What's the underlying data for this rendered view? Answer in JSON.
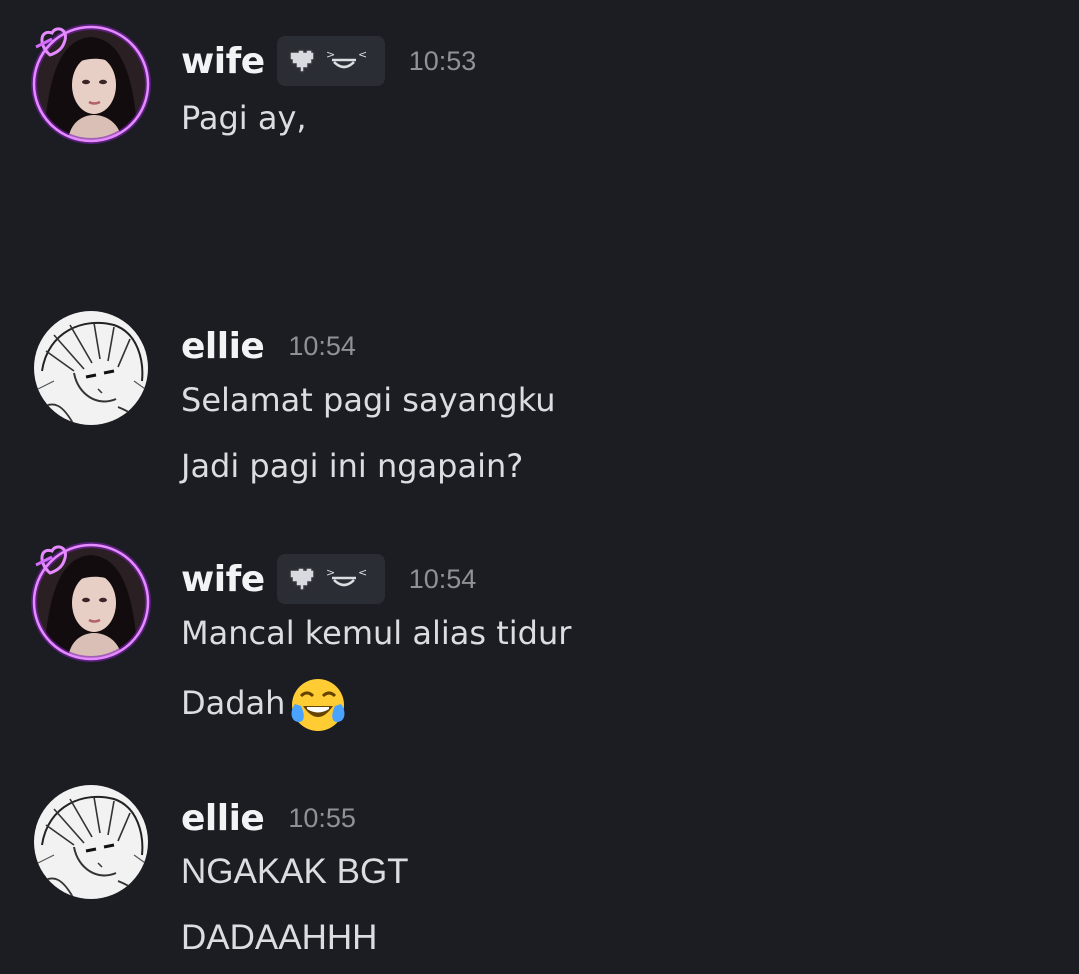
{
  "messages": [
    {
      "user": "wife",
      "time": "10:53",
      "lines": [
        "Pagi ay,"
      ],
      "avatar": "girl-portrait-avatar",
      "decoration": "neon-heart-ring"
    },
    {
      "user": "ellie",
      "time": "10:54",
      "lines": [
        "Selamat pagi sayangku",
        "Jadi pagi ini ngapain?"
      ],
      "avatar": "manga-sketch-avatar"
    },
    {
      "user": "wife",
      "time": "10:54",
      "lines": [
        "Mancal kemul alias tidur",
        "Dadah"
      ],
      "emoji": "tears-of-joy-emoji",
      "avatar": "girl-portrait-avatar",
      "decoration": "neon-heart-ring"
    },
    {
      "user": "ellie",
      "time": "10:55",
      "lines": [
        "NGAKAK BGT",
        "DADAAHHH"
      ],
      "avatar": "manga-sketch-avatar"
    }
  ],
  "colors": {
    "background": "#1c1d22",
    "username": "#f2f3f5",
    "text": "#dbdee1",
    "timestamp": "#8e9297",
    "ring": "#c44dff",
    "tag_bg": "#2b2d34"
  }
}
